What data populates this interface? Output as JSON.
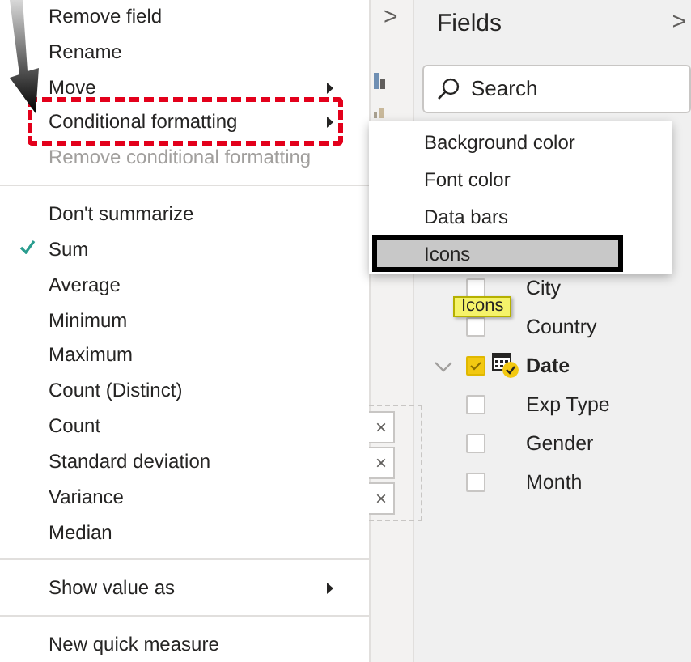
{
  "context_menu": {
    "items": [
      {
        "kind": "item",
        "label": "Remove field",
        "disabled": false,
        "checked": false,
        "outlined": false
      },
      {
        "kind": "item",
        "label": "Rename",
        "disabled": false,
        "checked": false,
        "outlined": false
      },
      {
        "kind": "submenu",
        "label": "Move",
        "disabled": false,
        "checked": false,
        "outlined": false
      },
      {
        "kind": "submenu",
        "label": "Conditional formatting",
        "disabled": false,
        "checked": false,
        "outlined": true
      },
      {
        "kind": "item",
        "label": "Remove conditional formatting",
        "disabled": true,
        "checked": false,
        "outlined": false
      },
      {
        "kind": "separator"
      },
      {
        "kind": "item",
        "label": "Don't summarize",
        "disabled": false,
        "checked": false,
        "outlined": false
      },
      {
        "kind": "item",
        "label": "Sum",
        "disabled": false,
        "checked": true,
        "outlined": false
      },
      {
        "kind": "item",
        "label": "Average",
        "disabled": false,
        "checked": false,
        "outlined": false
      },
      {
        "kind": "item",
        "label": "Minimum",
        "disabled": false,
        "checked": false,
        "outlined": false
      },
      {
        "kind": "item",
        "label": "Maximum",
        "disabled": false,
        "checked": false,
        "outlined": false
      },
      {
        "kind": "item",
        "label": "Count (Distinct)",
        "disabled": false,
        "checked": false,
        "outlined": false
      },
      {
        "kind": "item",
        "label": "Count",
        "disabled": false,
        "checked": false,
        "outlined": false
      },
      {
        "kind": "item",
        "label": "Standard deviation",
        "disabled": false,
        "checked": false,
        "outlined": false
      },
      {
        "kind": "item",
        "label": "Variance",
        "disabled": false,
        "checked": false,
        "outlined": false
      },
      {
        "kind": "item",
        "label": "Median",
        "disabled": false,
        "checked": false,
        "outlined": false
      },
      {
        "kind": "separator"
      },
      {
        "kind": "submenu",
        "label": "Show value as",
        "disabled": false,
        "checked": false,
        "outlined": false
      },
      {
        "kind": "separator"
      },
      {
        "kind": "item",
        "label": "New quick measure",
        "disabled": false,
        "checked": false,
        "outlined": false
      }
    ]
  },
  "submenu": {
    "items": [
      {
        "label": "Background color",
        "selected": false
      },
      {
        "label": "Font color",
        "selected": false
      },
      {
        "label": "Data bars",
        "selected": false
      },
      {
        "label": "Icons",
        "selected": true
      }
    ]
  },
  "tooltip": "Icons",
  "visualizations_strip": {
    "expand": ">",
    "remove_buttons": [
      "×",
      "×",
      "×"
    ]
  },
  "fields_pane": {
    "title": "Fields",
    "expand": ">",
    "search": {
      "placeholder": "Search"
    },
    "fields": [
      {
        "kind": "column",
        "label": "City",
        "checked": false
      },
      {
        "kind": "column",
        "label": "Country",
        "checked": false
      },
      {
        "kind": "date",
        "label": "Date",
        "checked": true,
        "expanded": true
      },
      {
        "kind": "column",
        "label": "Exp Type",
        "checked": false
      },
      {
        "kind": "column",
        "label": "Gender",
        "checked": false
      },
      {
        "kind": "column",
        "label": "Month",
        "checked": false
      }
    ]
  }
}
